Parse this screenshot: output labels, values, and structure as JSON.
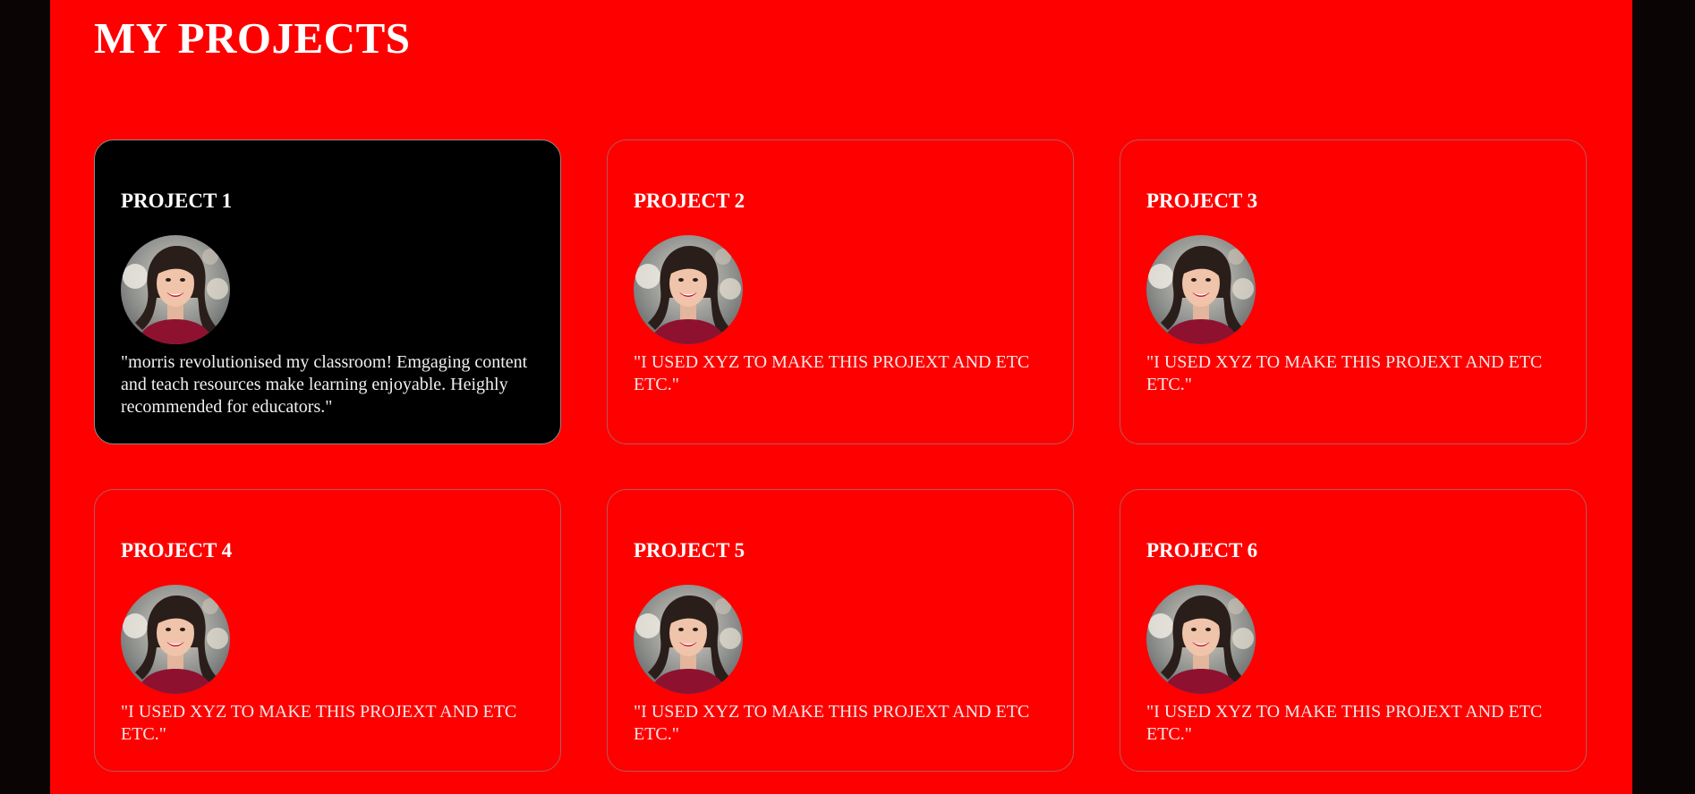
{
  "header": {
    "title": "MY PROJECTS"
  },
  "projects": [
    {
      "title": "PROJECT 1",
      "description": "\"morris revolutionised my classroom! Emgaging content and teach resources make learning enjoyable. Heighly recommended for educators.\"",
      "featured": true
    },
    {
      "title": "PROJECT 2",
      "description": "\"I USED XYZ TO MAKE THIS PROJEXT AND ETC ETC.\"",
      "featured": false
    },
    {
      "title": "PROJECT 3",
      "description": "\"I USED XYZ TO MAKE THIS PROJEXT AND ETC ETC.\"",
      "featured": false
    },
    {
      "title": "PROJECT 4",
      "description": "\"I USED XYZ TO MAKE THIS PROJEXT AND ETC ETC.\"",
      "featured": false
    },
    {
      "title": "PROJECT 5",
      "description": "\"I USED XYZ TO MAKE THIS PROJEXT AND ETC ETC.\"",
      "featured": false
    },
    {
      "title": "PROJECT 6",
      "description": "\"I USED XYZ TO MAKE THIS PROJEXT AND ETC ETC.\"",
      "featured": false
    }
  ],
  "colors": {
    "page_background": "#ff0000",
    "featured_card_background": "#000000",
    "outer_background": "#0a0404",
    "text": "#ffffff"
  },
  "icons": {
    "avatar": "user-photo-avatar"
  }
}
